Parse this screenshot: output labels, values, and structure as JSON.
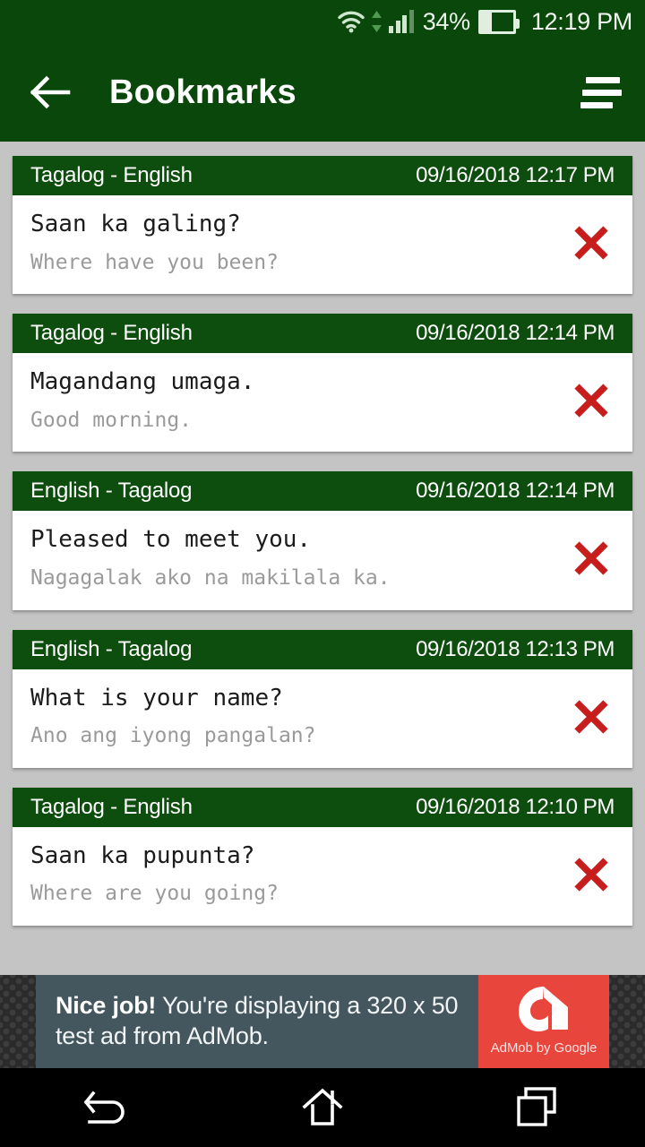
{
  "status_bar": {
    "wifi_icon": "wifi-icon",
    "data_transfer_icon": "data-transfer-arrows-icon",
    "signal_icon": "cellular-signal-icon",
    "battery_percent": "34%",
    "battery_level": 34,
    "battery_icon": "battery-icon",
    "clock": "12:19 PM"
  },
  "app_bar": {
    "back_icon": "back-arrow-icon",
    "title": "Bookmarks",
    "menu_icon": "hamburger-menu-icon"
  },
  "colors": {
    "app_bar_green": "#0a470a",
    "card_header_green": "#0d4d0d",
    "page_background": "#c4c4c4",
    "delete_red": "#c81d1d",
    "ad_slate": "#44565e",
    "admob_red": "#e8453c"
  },
  "bookmarks": [
    {
      "languages": "Tagalog - English",
      "timestamp": "09/16/2018 12:17 PM",
      "phrase": "Saan ka galing?",
      "translation": "Where have you been?",
      "delete_icon": "delete-x-icon"
    },
    {
      "languages": "Tagalog - English",
      "timestamp": "09/16/2018 12:14 PM",
      "phrase": "Magandang umaga.",
      "translation": "Good morning.",
      "delete_icon": "delete-x-icon"
    },
    {
      "languages": "English - Tagalog",
      "timestamp": "09/16/2018 12:14 PM",
      "phrase": "Pleased to meet you.",
      "translation": "Nagagalak ako na makilala ka.",
      "delete_icon": "delete-x-icon"
    },
    {
      "languages": "English - Tagalog",
      "timestamp": "09/16/2018 12:13 PM",
      "phrase": "What is your name?",
      "translation": "Ano ang iyong pangalan?",
      "delete_icon": "delete-x-icon"
    },
    {
      "languages": "Tagalog - English",
      "timestamp": "09/16/2018 12:10 PM",
      "phrase": "Saan ka pupunta?",
      "translation": "Where are you going?",
      "delete_icon": "delete-x-icon"
    }
  ],
  "ad": {
    "headline": "Nice job!",
    "body": " You're displaying a 320 x 50 test ad from AdMob.",
    "logo_caption": "AdMob by Google",
    "logo_icon": "admob-logo-icon"
  },
  "nav_bar": {
    "back_icon": "nav-back-icon",
    "home_icon": "nav-home-icon",
    "recents_icon": "nav-recents-icon"
  }
}
